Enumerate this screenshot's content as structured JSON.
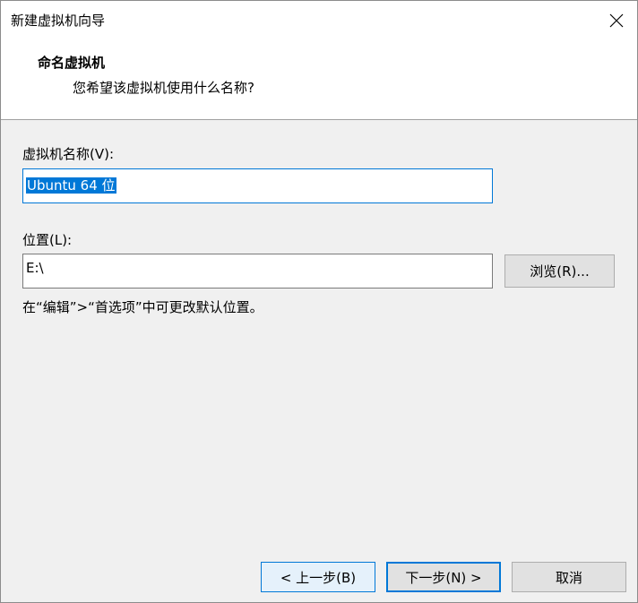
{
  "window": {
    "title": "新建虚拟机向导"
  },
  "header": {
    "title": "命名虚拟机",
    "subtitle": "您希望该虚拟机使用什么名称?"
  },
  "form": {
    "name_label": "虚拟机名称(V):",
    "name_value": "Ubuntu 64 位",
    "location_label": "位置(L):",
    "location_value": "E:\\",
    "browse_label": "浏览(R)...",
    "hint": "在“编辑”>“首选项”中可更改默认位置。"
  },
  "buttons": {
    "back": "< 上一步(B)",
    "next": "下一步(N) >",
    "cancel": "取消"
  },
  "colors": {
    "accent": "#0078d7",
    "face": "#f0f0f0",
    "button": "#e1e1e1"
  }
}
